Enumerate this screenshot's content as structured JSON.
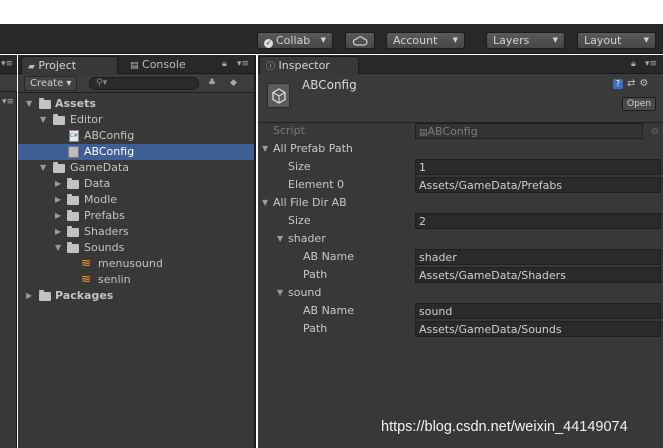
{
  "toolbar": {
    "collab": "Collab",
    "cloud_icon": "cloud-icon",
    "account": "Account",
    "layers": "Layers",
    "layout": "Layout"
  },
  "project": {
    "tab_label": "Project",
    "console_label": "Console",
    "create_label": "Create",
    "tree": [
      {
        "label": "Assets"
      },
      {
        "label": "Editor"
      },
      {
        "label": "ABConfig"
      },
      {
        "label": "ABConfig"
      },
      {
        "label": "GameData"
      },
      {
        "label": "Data"
      },
      {
        "label": "Modle"
      },
      {
        "label": "Prefabs"
      },
      {
        "label": "Shaders"
      },
      {
        "label": "Sounds"
      },
      {
        "label": "menusound"
      },
      {
        "label": "senlin"
      },
      {
        "label": "Packages"
      }
    ]
  },
  "inspector": {
    "tab_label": "Inspector",
    "asset_name": "ABConfig",
    "open_label": "Open",
    "script_label": "Script",
    "script_value": "ABConfig",
    "all_prefab_path": "All Prefab Path",
    "size_label": "Size",
    "prefab_size": "1",
    "element0_label": "Element 0",
    "element0_value": "Assets/GameData/Prefabs",
    "all_file_dir_ab": "All File Dir AB",
    "dir_size": "2",
    "entries": [
      {
        "foldout": "shader",
        "ab_name_label": "AB Name",
        "ab_name": "shader",
        "path_label": "Path",
        "path": "Assets/GameData/Shaders"
      },
      {
        "foldout": "sound",
        "ab_name_label": "AB Name",
        "ab_name": "sound",
        "path_label": "Path",
        "path": "Assets/GameData/Sounds"
      }
    ]
  },
  "watermark": "https://blog.csdn.net/weixin_44149074"
}
